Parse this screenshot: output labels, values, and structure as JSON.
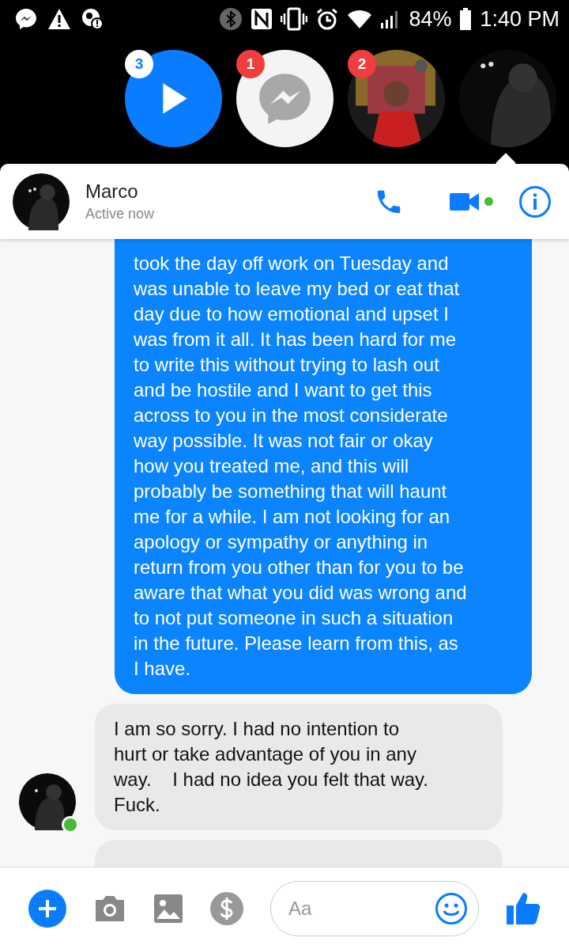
{
  "status_bar": {
    "battery": "84%",
    "time": "1:40 PM"
  },
  "chat_heads": [
    {
      "kind": "play",
      "badge": "3"
    },
    {
      "kind": "messenger",
      "badge": "1"
    },
    {
      "kind": "picture",
      "badge": "2"
    },
    {
      "kind": "picture"
    }
  ],
  "header": {
    "name": "Marco",
    "status": "Active now",
    "online": true
  },
  "messages": [
    {
      "kind": "sent",
      "lines": [
        "took the day off work on Tuesday and",
        "was unable to leave my bed or eat that",
        "day due to how emotional and upset I",
        "was from it all. It has been hard for me",
        "to write this without trying to lash out",
        "and be hostile and I want to get this",
        "across to you in the most considerate",
        "way possible. It was not fair or okay",
        "how you treated me, and this will",
        "probably be something that will haunt",
        "me for a while. I am not looking for an",
        "apology or sympathy or anything in",
        "return from you other than for you to be",
        "aware that what you did was wrong and",
        "to not put someone in such a situation",
        "in the future. Please learn from this, as",
        "I have."
      ]
    },
    {
      "kind": "received",
      "avatar": true,
      "lines": [
        "I am so sorry. I had no intention to",
        "hurt or take advantage of you in any",
        "way.    I had no idea you felt that way.",
        "Fuck."
      ]
    },
    {
      "kind": "received",
      "avatar": false
    }
  ],
  "composer": {
    "placeholder": "Aa"
  }
}
